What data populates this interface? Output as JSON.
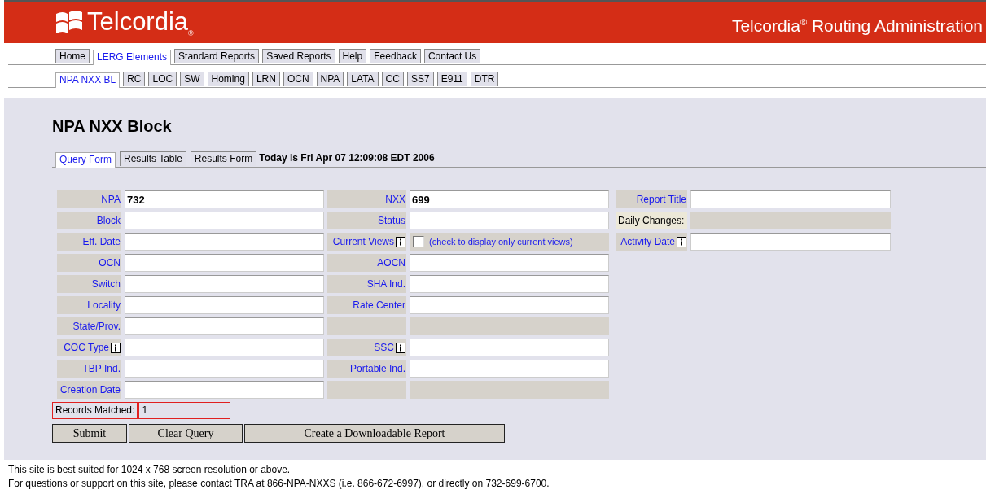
{
  "header": {
    "logo": "Telcordia$_{®}$",
    "title": "Telcordia$^{®}$ Routing Administration"
  },
  "nav": [
    {
      "label": "Home",
      "selected": false
    },
    {
      "label": "LERG Elements",
      "selected": true
    },
    {
      "label": "Standard Reports",
      "selected": false
    },
    {
      "label": "Saved Reports",
      "selected": false
    },
    {
      "label": "Help",
      "selected": false
    },
    {
      "label": "Feedback",
      "selected": false
    },
    {
      "label": "Contact Us",
      "selected": false
    }
  ],
  "subnav": [
    {
      "label": "NPA NXX BL",
      "selected": true
    },
    {
      "label": "RC",
      "selected": false
    },
    {
      "label": "LOC",
      "selected": false
    },
    {
      "label": "SW",
      "selected": false
    },
    {
      "label": "Homing",
      "selected": false
    },
    {
      "label": "LRN",
      "selected": false
    },
    {
      "label": "OCN",
      "selected": false
    },
    {
      "label": "NPA",
      "selected": false
    },
    {
      "label": "LATA",
      "selected": false
    },
    {
      "label": "CC",
      "selected": false
    },
    {
      "label": "SS7",
      "selected": false
    },
    {
      "label": "E911",
      "selected": false
    },
    {
      "label": "DTR",
      "selected": false
    }
  ],
  "page_title": "NPA NXX Block",
  "form_tabs": [
    {
      "label": "Query Form",
      "selected": true
    },
    {
      "label": "Results Table",
      "selected": false
    },
    {
      "label": "Results Form",
      "selected": false
    }
  ],
  "today": "Today is Fri Apr 07 12:09:08 EDT 2006",
  "rows": [
    {
      "left": {
        "kind": "input",
        "label": "NPA",
        "value": "732",
        "info": false
      },
      "right": {
        "kind": "input",
        "label": "NXX",
        "value": "699",
        "info": false
      }
    },
    {
      "left": {
        "kind": "input",
        "label": "Block",
        "info": false
      },
      "right": {
        "kind": "input",
        "label": "Status",
        "info": false
      }
    },
    {
      "left": {
        "kind": "input",
        "label": "Eff. Date",
        "info": false
      },
      "right": {
        "kind": "checkbox",
        "label": "Current Views",
        "info": true,
        "checked": false,
        "note": "(check to display only current views)"
      }
    },
    {
      "left": {
        "kind": "input",
        "label": "OCN",
        "info": false
      },
      "right": {
        "kind": "input",
        "label": "AOCN",
        "info": false
      }
    },
    {
      "left": {
        "kind": "input",
        "label": "Switch",
        "info": false
      },
      "right": {
        "kind": "input",
        "label": "SHA Ind.",
        "info": false
      }
    },
    {
      "left": {
        "kind": "input",
        "label": "Locality",
        "info": false
      },
      "right": {
        "kind": "input",
        "label": "Rate Center",
        "info": false
      }
    },
    {
      "left": {
        "kind": "input",
        "label": "State/Prov.",
        "info": false
      },
      "right": {
        "kind": "empty"
      }
    },
    {
      "left": {
        "kind": "input",
        "label": "COC Type",
        "info": true
      },
      "right": {
        "kind": "input",
        "label": "SSC",
        "info": true
      }
    },
    {
      "left": {
        "kind": "input",
        "label": "TBP Ind.",
        "info": false
      },
      "right": {
        "kind": "input",
        "label": "Portable Ind.",
        "info": false
      }
    },
    {
      "left": {
        "kind": "input",
        "label": "Creation Date",
        "info": false
      },
      "right": {
        "kind": "empty"
      }
    }
  ],
  "report_fields": [
    {
      "kind": "input",
      "label": "Report Title",
      "info": false
    },
    {
      "kind": "static",
      "label": "Daily Changes:"
    },
    {
      "kind": "input",
      "label": "Activity Date",
      "info": true
    }
  ],
  "records_matched": {
    "label": "Records Matched:",
    "value": "1"
  },
  "buttons": [
    "Submit",
    "Clear Query",
    "Create a Downloadable Report"
  ],
  "footer": [
    "This site is best suited for 1024 x 768 screen resolution or above.",
    "For questions or support on this site, please contact TRA at 866-NPA-NXXS (i.e. 866-672-6997), or directly on 732-699-6700."
  ]
}
